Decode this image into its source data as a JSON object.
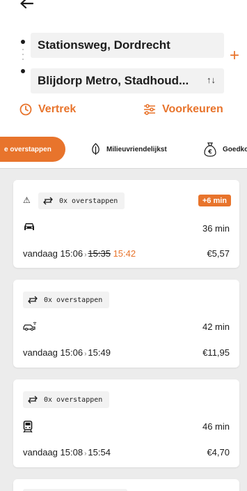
{
  "route": {
    "from": "Stationsweg, Dordrecht",
    "to": "Blijdorp Metro, Stadhoud...",
    "swap_glyph": "↑↓",
    "add_glyph": "+"
  },
  "options": {
    "departure_label": "Vertrek",
    "preferences_label": "Voorkeuren"
  },
  "filters": [
    {
      "label": "e overstappen",
      "active": true,
      "icon": "none"
    },
    {
      "label": "Milieuvriendelijkst",
      "active": false,
      "icon": "leaf-icon"
    },
    {
      "label": "Goedko",
      "active": false,
      "icon": "money-bag-icon"
    }
  ],
  "results": [
    {
      "warning": true,
      "transfers": "0x overstappen",
      "delay_badge": "+6 min",
      "mode_icon": "car-icon",
      "duration": "36 min",
      "day": "vandaag",
      "depart": "15:06",
      "arrive_planned": "15:35",
      "arrive_actual": "15:42",
      "price": "€5,57"
    },
    {
      "warning": false,
      "transfers": "0x overstappen",
      "mode_icon": "shared-car-icon",
      "duration": "42 min",
      "day": "vandaag",
      "depart": "15:06",
      "arrive": "15:49",
      "price": "€11,95"
    },
    {
      "warning": false,
      "transfers": "0x overstappen",
      "mode_icon": "train-icon",
      "duration": "46 min",
      "day": "vandaag",
      "depart": "15:08",
      "arrive": "15:54",
      "price": "€4,70"
    }
  ],
  "colors": {
    "accent": "#e8742c",
    "field_bg": "#f2f2f2",
    "list_bg": "#ececec"
  }
}
